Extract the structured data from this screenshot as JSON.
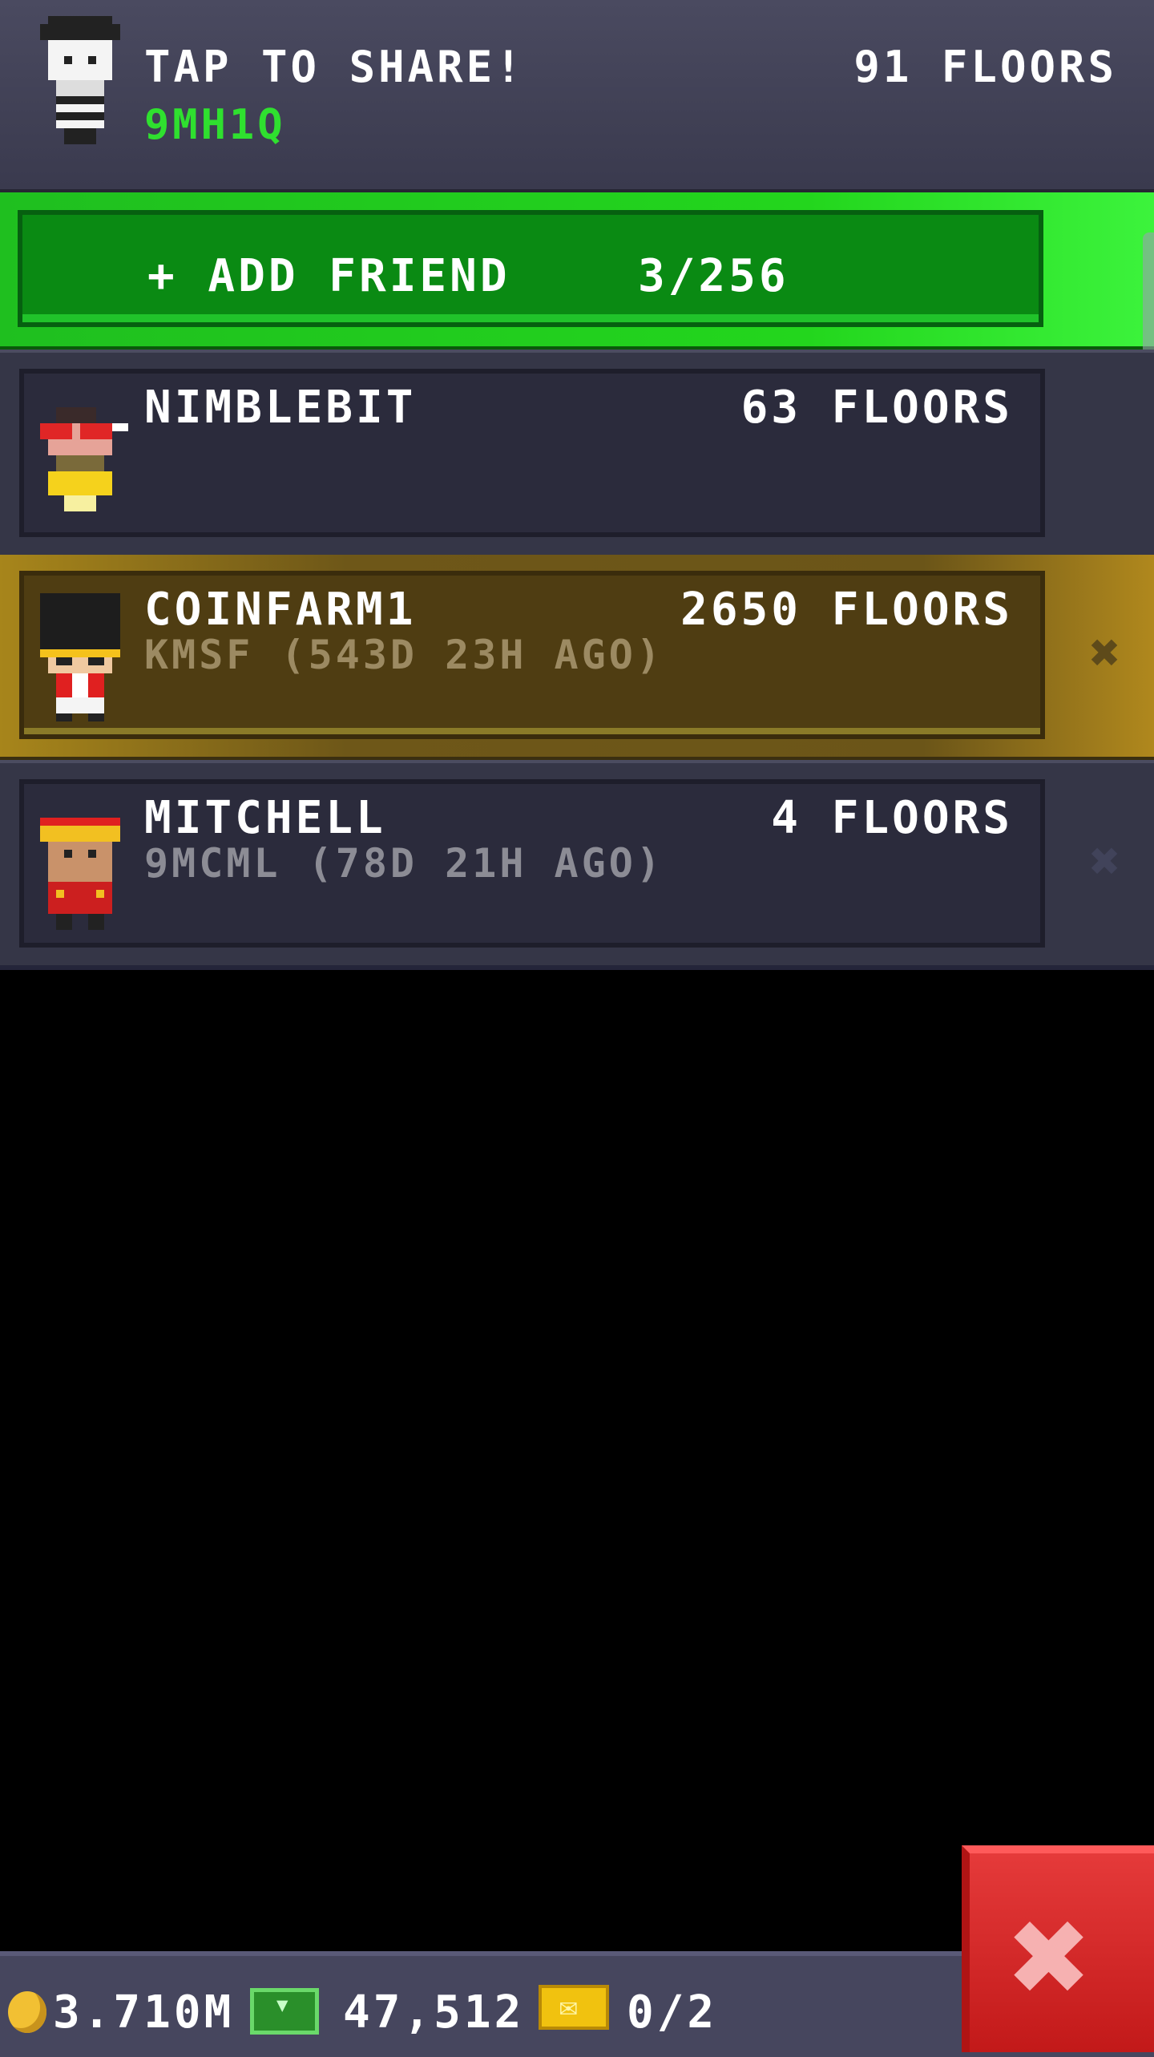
{
  "header": {
    "share_label": "TAP TO SHARE!",
    "code": "9MH1Q",
    "floors": "91 FLOORS"
  },
  "add_friend": {
    "label": "+ ADD FRIEND",
    "count": "3/256"
  },
  "friends": [
    {
      "name": "NIMBLEBIT",
      "floors": "63 FLOORS",
      "subtitle": ""
    },
    {
      "name": "COINFARM1",
      "floors": "2650 FLOORS",
      "subtitle": "KMSF (543D 23H AGO)"
    },
    {
      "name": "MITCHELL",
      "floors": "4 FLOORS",
      "subtitle": "9MCML (78D 21H AGO)"
    }
  ],
  "bottom_bar": {
    "coins": "3.710M",
    "bux": "47,512",
    "tickets": "0/2"
  },
  "icons": {
    "close": "close-icon",
    "remove": "remove-friend-icon"
  },
  "colors": {
    "code_green": "#2fe02f",
    "add_bar_green": "#23d61d",
    "highlight_gold": "#a7851b",
    "close_red": "#d72a2a"
  }
}
